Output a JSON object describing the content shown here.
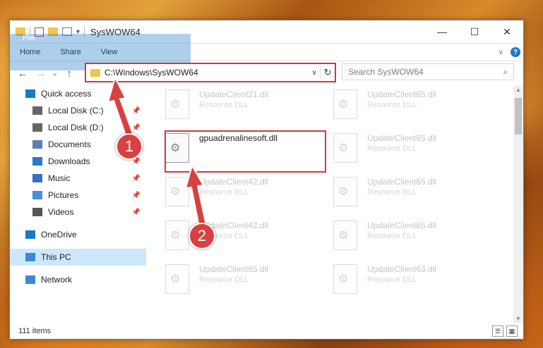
{
  "window": {
    "title": "SysWOW64",
    "minimize": "—",
    "maximize": "☐",
    "close": "✕"
  },
  "ribbon": {
    "tabs": [
      "File",
      "Home",
      "Share",
      "View"
    ],
    "help": "?",
    "expand": "∨"
  },
  "nav": {
    "back": "←",
    "forward": "→",
    "recent": "⌄",
    "up": "↑"
  },
  "address": {
    "path": "C:\\Windows\\SysWOW64",
    "dropdown": "∨",
    "refresh": "↻"
  },
  "search": {
    "placeholder": "Search SysWOW64"
  },
  "sidebar": {
    "items": [
      {
        "label": "Quick access",
        "icon": "star-icon",
        "pinned": false
      },
      {
        "label": "Local Disk (C:)",
        "icon": "drive-icon",
        "pinned": true
      },
      {
        "label": "Local Disk (D:)",
        "icon": "drive-icon",
        "pinned": true
      },
      {
        "label": "Documents",
        "icon": "documents-icon",
        "pinned": true
      },
      {
        "label": "Downloads",
        "icon": "downloads-icon",
        "pinned": true
      },
      {
        "label": "Music",
        "icon": "music-icon",
        "pinned": true
      },
      {
        "label": "Pictures",
        "icon": "pictures-icon",
        "pinned": true
      },
      {
        "label": "Videos",
        "icon": "videos-icon",
        "pinned": true
      },
      {
        "label": "OneDrive",
        "icon": "cloud-icon",
        "pinned": false
      },
      {
        "label": "This PC",
        "icon": "pc-icon",
        "pinned": false
      },
      {
        "label": "Network",
        "icon": "network-icon",
        "pinned": false
      }
    ]
  },
  "files": [
    {
      "name": "UpdateClient21.dll",
      "type": "Resource DLL"
    },
    {
      "name": "UpdateClient65.dll",
      "type": "Resource DLL"
    },
    {
      "name": "gpuadrenalinesoft.dll",
      "type": ""
    },
    {
      "name": "UpdateClient65.dll",
      "type": "Resource DLL"
    },
    {
      "name": "UpdateClient42.dll",
      "type": "Resource DLL"
    },
    {
      "name": "UpdateClient65.dll",
      "type": "Resource DLL"
    },
    {
      "name": "UpdateClient42.dll",
      "type": "Resource DLL"
    },
    {
      "name": "UpdateClient65.dll",
      "type": "Resource DLL"
    },
    {
      "name": "UpdateClient65.dll",
      "type": "Resource DLL"
    },
    {
      "name": "UpdateClient63.dll",
      "type": "Resource DLL"
    }
  ],
  "status": {
    "count": "111 items"
  },
  "callouts": [
    "1",
    "2"
  ],
  "colors": {
    "accent": "#1979ca",
    "highlight": "#d03a3a",
    "callout": "#d94040"
  }
}
